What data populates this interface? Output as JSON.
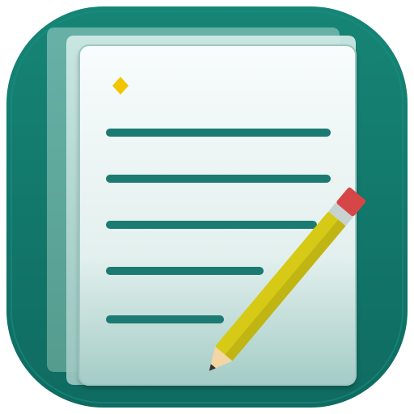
{
  "app_icon": {
    "icon": "notes-pencil-icon",
    "colors": {
      "background": "#137a6e",
      "background_shade": "#0e665c",
      "page_back": "#76b8ae",
      "page_mid": "#b9dbd6",
      "page_front_top": "#f6fbfb",
      "page_front_bottom": "#a5cdc6",
      "line": "#1b7b72",
      "marker": "#f2c500",
      "pencil_body": "#d6ca17",
      "pencil_body_shadow": "#b8ae13",
      "pencil_band": "#c7d3d1",
      "pencil_eraser": "#d64646",
      "pencil_wood": "#f3d6a4",
      "pencil_tip": "#333333"
    },
    "text_lines": [
      {
        "length": 1.0
      },
      {
        "length": 1.0
      },
      {
        "length": 0.94
      },
      {
        "length": 0.7
      },
      {
        "length": 0.52
      }
    ]
  }
}
